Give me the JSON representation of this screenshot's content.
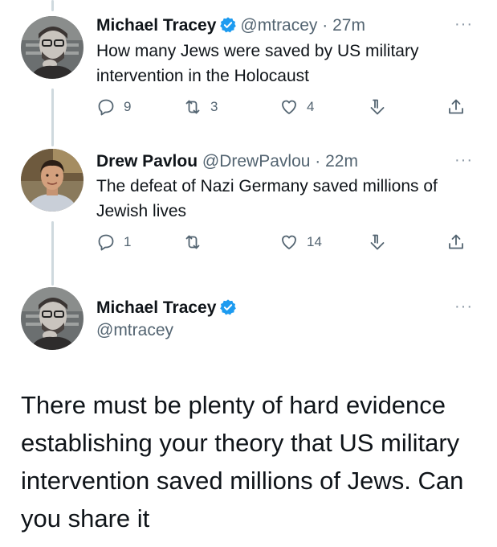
{
  "colors": {
    "verified": "#1d9bf0",
    "text": "#0f1419",
    "muted": "#536471"
  },
  "tweets": [
    {
      "name": "Michael Tracey",
      "handle": "@mtracey",
      "dot": "·",
      "time": "27m",
      "more": "···",
      "text": "How many Jews were saved by US military intervention in the Holocaust",
      "replies": "9",
      "retweets": "3",
      "likes": "4"
    },
    {
      "name": "Drew Pavlou",
      "handle": "@DrewPavlou",
      "dot": "·",
      "time": "22m",
      "more": "···",
      "text": "The defeat of Nazi Germany saved millions of Jewish lives",
      "replies": "1",
      "retweets": "",
      "likes": "14"
    }
  ],
  "main_tweet": {
    "name": "Michael Tracey",
    "handle": "@mtracey",
    "more": "···",
    "text": "There must be plenty of hard evidence establishing your theory that US military intervention saved millions of Jews. Can you share it"
  },
  "icons": [
    "verified-badge-icon",
    "reply-icon",
    "retweet-icon",
    "like-icon",
    "bookmark-icon",
    "share-icon",
    "more-icon"
  ]
}
